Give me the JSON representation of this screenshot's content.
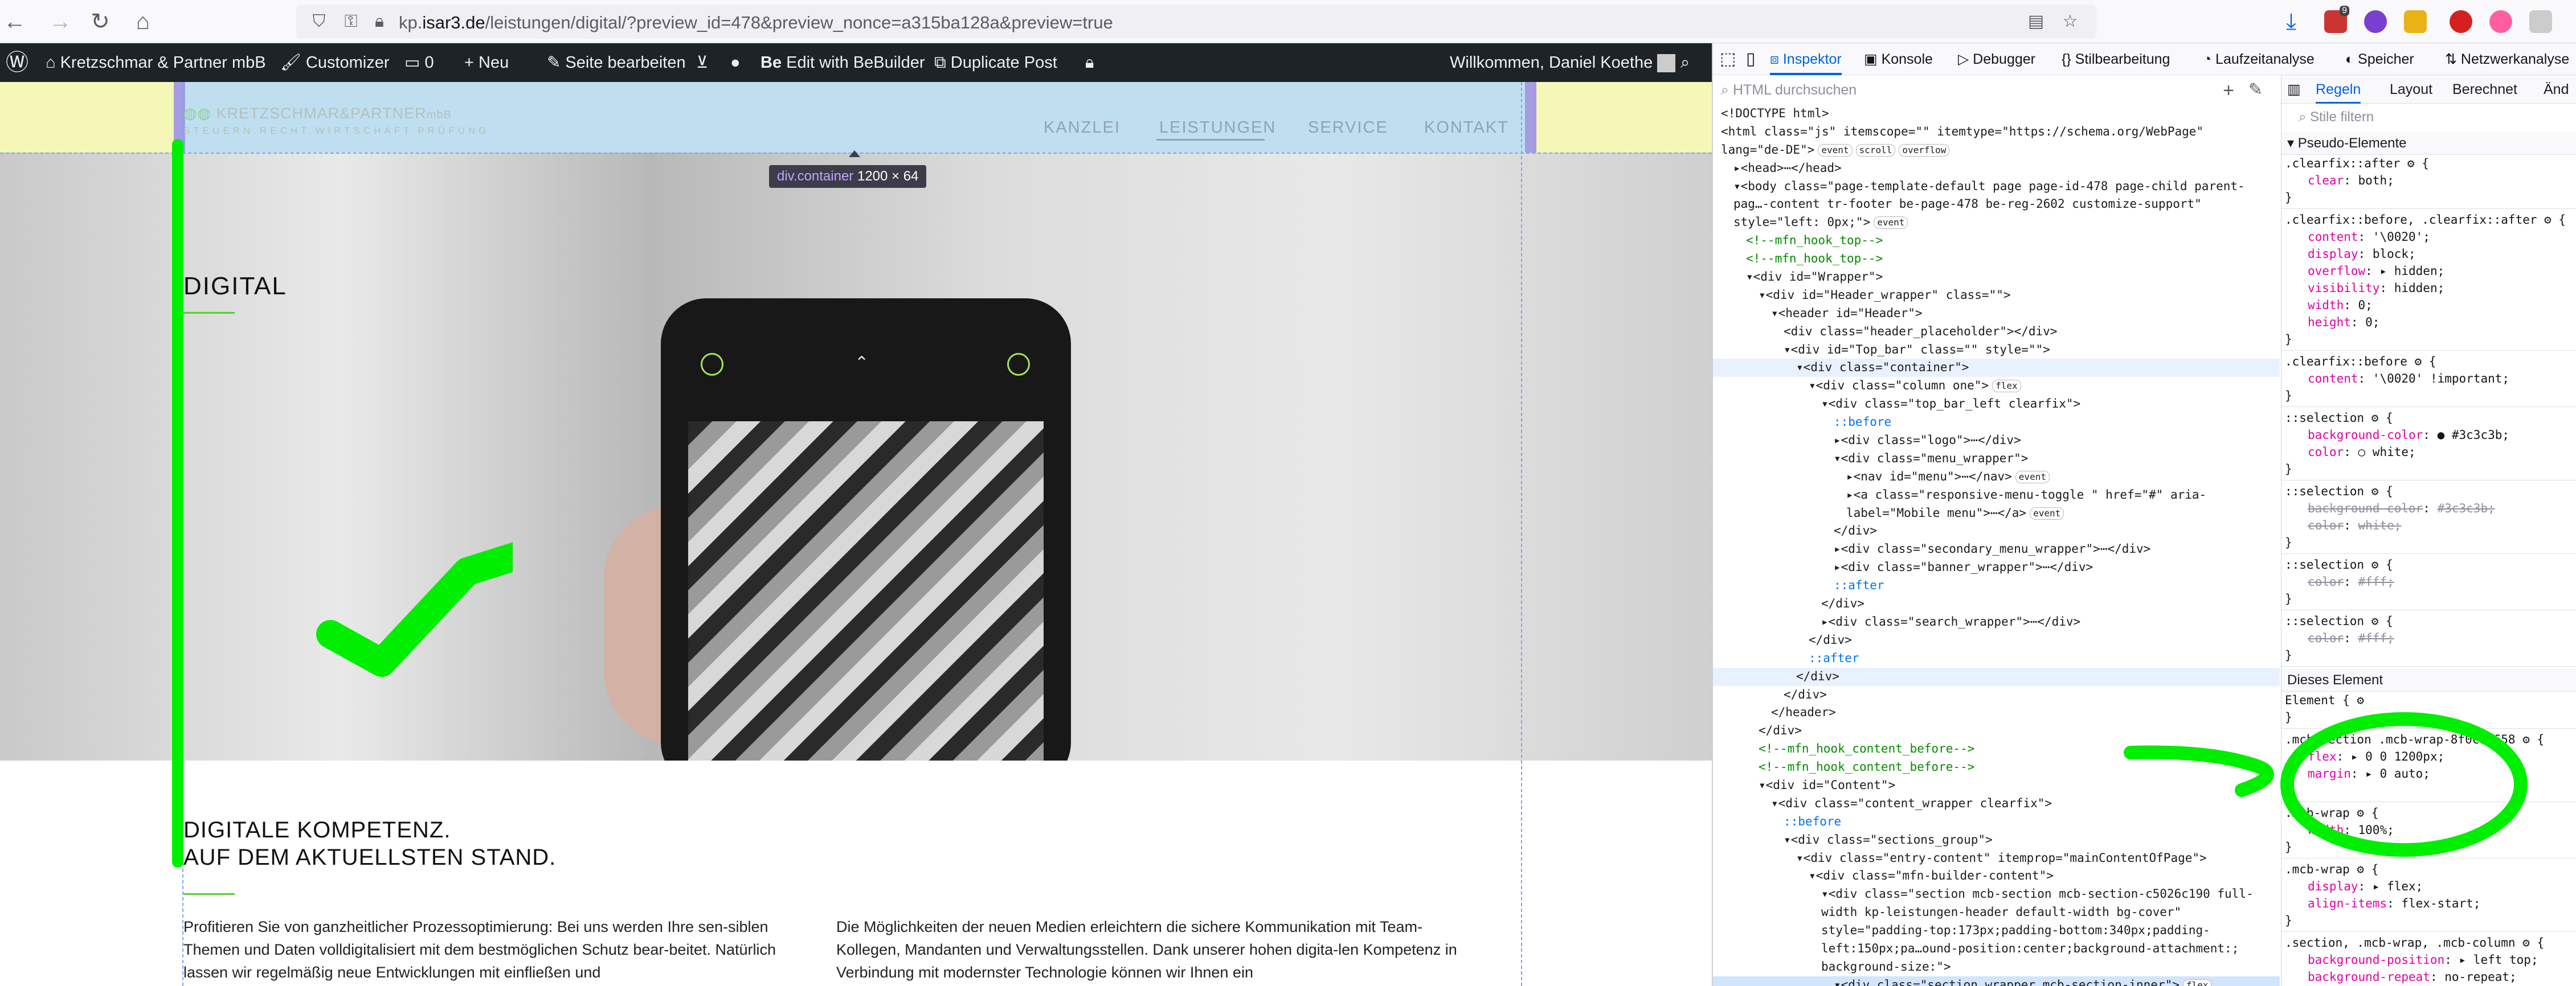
{
  "browser": {
    "url_prefix": "kp.",
    "url_host": "isar3.de",
    "url_path": "/leistungen/digital/?preview_id=478&preview_nonce=a315ba128a&preview=true",
    "ext_badge": "9"
  },
  "wpbar": {
    "site_name": "Kretzschmar & Partner mbB",
    "customizer": "Customizer",
    "comments": "0",
    "new": "Neu",
    "edit_page": "Seite bearbeiten",
    "bebuilder": "Edit with BeBuilder",
    "duplicate": "Duplicate Post",
    "welcome": "Willkommen, Daniel Koethe"
  },
  "site": {
    "logo_main": "KRETZSCHMAR&PARTNER",
    "logo_suffix": "mbB",
    "logo_sub": "STEUERN.RECHT.WIRTSCHAFT.PRÜFUNG",
    "menu": [
      "KANZLEI",
      "LEISTUNGEN",
      "SERVICE",
      "KONTAKT"
    ],
    "tooltip_tag": "div.container",
    "tooltip_size": "1200 × 64",
    "hero_title": "DIGITAL",
    "headline_1": "DIGITALE KOMPETENZ.",
    "headline_2": "AUF DEM AKTUELLSTEN STAND.",
    "para_left": "Profitieren Sie von ganzheitlicher Prozessoptimierung: Bei uns werden Ihre sen-siblen Themen und Daten volldigitalisiert mit dem bestmöglichen Schutz bear-beitet. Natürlich lassen wir regelmäßig neue Entwicklungen mit einfließen und",
    "para_right": "Die Möglichkeiten der neuen Medien erleichtern die sichere Kommunikation mit Team-Kollegen, Mandanten und Verwaltungsstellen. Dank unserer hohen digita-len Kompetenz in Verbindung mit modernster Technologie können wir Ihnen ein"
  },
  "devtools": {
    "tabs": [
      "Inspektor",
      "Konsole",
      "Debugger",
      "Stilbearbeitung",
      "Laufzeitanalyse",
      "Speicher",
      "Netzwerkanalyse"
    ],
    "html_search_placeholder": "HTML durchsuchen",
    "tree": [
      {
        "i": 0,
        "t": "<!DOCTYPE html>"
      },
      {
        "i": 0,
        "t": "<html class=\"js\" itemscope=\"\" itemtype=\"https://schema.org/WebPage\""
      },
      {
        "i": 0,
        "t": "lang=\"de-DE\">",
        "b": [
          "event",
          "scroll",
          "overflow"
        ]
      },
      {
        "i": 1,
        "t": "▸<head>⋯</head>"
      },
      {
        "i": 1,
        "t": "▾<body class=\"page-template-default page page-id-478 page-child parent-"
      },
      {
        "i": 1,
        "t": " pag…-content tr-footer be-page-478 be-reg-2602 customize-support\""
      },
      {
        "i": 1,
        "t": " style=\"left: 0px;\">",
        "b": [
          "event"
        ]
      },
      {
        "i": 2,
        "t": "<!--mfn_hook_top-->",
        "c": true
      },
      {
        "i": 2,
        "t": "<!--mfn_hook_top-->",
        "c": true
      },
      {
        "i": 2,
        "t": "▾<div id=\"Wrapper\">"
      },
      {
        "i": 3,
        "t": "▾<div id=\"Header_wrapper\" class=\"\">"
      },
      {
        "i": 4,
        "t": "▾<header id=\"Header\">"
      },
      {
        "i": 5,
        "t": "<div class=\"header_placeholder\"></div>"
      },
      {
        "i": 5,
        "t": "▾<div id=\"Top_bar\" class=\"\" style=\"\">"
      },
      {
        "i": 6,
        "t": "▾<div class=\"container\">",
        "h": true
      },
      {
        "i": 7,
        "t": "▾<div class=\"column one\">",
        "b": [
          "flex"
        ]
      },
      {
        "i": 8,
        "t": "▾<div class=\"top_bar_left clearfix\">"
      },
      {
        "i": 9,
        "t": "::before",
        "p": true
      },
      {
        "i": 9,
        "t": "▸<div class=\"logo\">⋯</div>"
      },
      {
        "i": 9,
        "t": "▾<div class=\"menu_wrapper\">"
      },
      {
        "i": 10,
        "t": "▸<nav id=\"menu\">⋯</nav>",
        "b": [
          "event"
        ]
      },
      {
        "i": 10,
        "t": "▸<a class=\"responsive-menu-toggle \" href=\"#\" aria-"
      },
      {
        "i": 10,
        "t": "  label=\"Mobile menu\">⋯</a>",
        "b": [
          "event"
        ]
      },
      {
        "i": 9,
        "t": "</div>"
      },
      {
        "i": 9,
        "t": "▸<div class=\"secondary_menu_wrapper\">⋯</div>"
      },
      {
        "i": 9,
        "t": "▸<div class=\"banner_wrapper\">⋯</div>"
      },
      {
        "i": 9,
        "t": "::after",
        "p": true
      },
      {
        "i": 8,
        "t": "</div>"
      },
      {
        "i": 8,
        "t": "▸<div class=\"search_wrapper\">⋯</div>"
      },
      {
        "i": 7,
        "t": "</div>"
      },
      {
        "i": 7,
        "t": "::after",
        "p": true
      },
      {
        "i": 6,
        "t": "</div>",
        "h": true
      },
      {
        "i": 5,
        "t": "</div>"
      },
      {
        "i": 4,
        "t": "</header>"
      },
      {
        "i": 3,
        "t": "</div>"
      },
      {
        "i": 3,
        "t": "<!--mfn_hook_content_before-->",
        "c": true
      },
      {
        "i": 3,
        "t": "<!--mfn_hook_content_before-->",
        "c": true
      },
      {
        "i": 3,
        "t": "▾<div id=\"Content\">"
      },
      {
        "i": 4,
        "t": "▾<div class=\"content_wrapper clearfix\">"
      },
      {
        "i": 5,
        "t": "::before",
        "p": true
      },
      {
        "i": 5,
        "t": "▾<div class=\"sections_group\">"
      },
      {
        "i": 6,
        "t": "▾<div class=\"entry-content\" itemprop=\"mainContentOfPage\">"
      },
      {
        "i": 7,
        "t": "▾<div class=\"mfn-builder-content\">"
      },
      {
        "i": 8,
        "t": "▾<div class=\"section mcb-section mcb-section-c5026c190 full-"
      },
      {
        "i": 8,
        "t": "  width kp-leistungen-header default-width bg-cover\""
      },
      {
        "i": 8,
        "t": "  style=\"padding-top:173px;padding-bottom:340px;padding-"
      },
      {
        "i": 8,
        "t": "  left:150px;pa…ound-position:center;background-attachment:;"
      },
      {
        "i": 8,
        "t": "  background-size:\">"
      },
      {
        "i": 9,
        "t": "▾<div class=\"section_wrapper mcb-section-inner\">",
        "b": [
          "flex"
        ],
        "s": true
      }
    ],
    "rules_tabs": [
      "Regeln",
      "Layout",
      "Berechnet",
      "Änd"
    ],
    "rules_filter_placeholder": "Stile filtern",
    "section_pseudo": "Pseudo-Elemente",
    "section_element": "Dieses Element",
    "rules": [
      {
        "sel": ".clearfix::after ⚙ {"
      },
      {
        "p": "clear",
        "v": "both;"
      },
      {
        "close": true
      },
      {
        "sel": ".clearfix::before, .clearfix::after ⚙ {"
      },
      {
        "p": "content",
        "v": "'\\0020';"
      },
      {
        "p": "display",
        "v": "block;"
      },
      {
        "p": "overflow",
        "v": "▸ hidden;"
      },
      {
        "p": "visibility",
        "v": "hidden;"
      },
      {
        "p": "width",
        "v": "0;"
      },
      {
        "p": "height",
        "v": "0;"
      },
      {
        "close": true
      },
      {
        "sel": ".clearfix::before ⚙ {"
      },
      {
        "p": "content",
        "v": "'\\0020' !important;"
      },
      {
        "close": true
      },
      {
        "sel": "::selection ⚙ {"
      },
      {
        "p": "background-color",
        "v": "● #3c3c3b;"
      },
      {
        "p": "color",
        "v": "○ white;"
      },
      {
        "close": true
      },
      {
        "sel": "::selection ⚙ {"
      },
      {
        "p": "background-color",
        "v": "#3c3c3b;",
        "x": true
      },
      {
        "p": "color",
        "v": "white;",
        "x": true
      },
      {
        "close": true
      },
      {
        "sel": "::selection ⚙ {"
      },
      {
        "p": "color",
        "v": "#fff;",
        "x": true
      },
      {
        "close": true
      },
      {
        "sel": "::selection ⚙ {"
      },
      {
        "p": "color",
        "v": "#fff;",
        "x": true
      },
      {
        "close": true
      }
    ],
    "element_rules": [
      {
        "sel": "Element { ⚙"
      },
      {
        "close": true
      },
      {
        "sel": ".mcb-section .mcb-wrap-8f0ca8658 ⚙ {"
      },
      {
        "p": "flex",
        "v": "▸ 0 0 1200px;"
      },
      {
        "p": "margin",
        "v": "▸ 0 auto;"
      },
      {
        "close": true
      },
      {
        "sel": ".mcb-wrap ⚙ {"
      },
      {
        "p": "width",
        "v": "100%;"
      },
      {
        "close": true
      },
      {
        "sel": ".mcb-wrap ⚙ {"
      },
      {
        "p": "display",
        "v": "▸ flex;"
      },
      {
        "p": "align-items",
        "v": "flex-start;"
      },
      {
        "close": true
      },
      {
        "sel": ".section, .mcb-wrap, .mcb-column ⚙ {"
      },
      {
        "p": "background-position",
        "v": "▸ left top;"
      },
      {
        "p": "background-repeat",
        "v": "no-repeat;"
      }
    ]
  },
  "colors": {
    "annotation_green": "#00ee00",
    "accent_blue": "#0061e0",
    "wp_bar": "#1d2327"
  }
}
